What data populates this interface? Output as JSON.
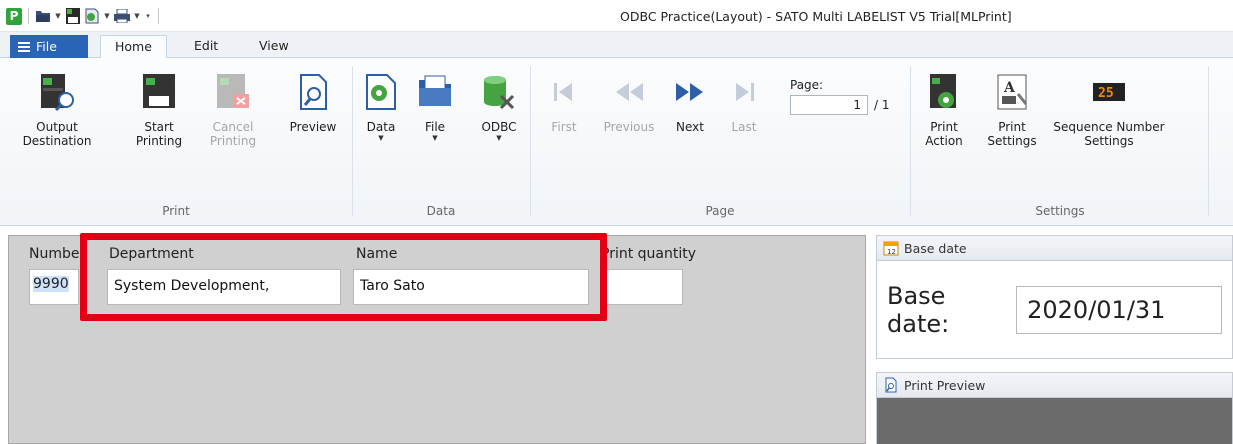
{
  "window": {
    "title": "ODBC Practice(Layout) - SATO Multi LABELIST V5 Trial[MLPrint]",
    "app_icon_letter": "P"
  },
  "tabs": {
    "file": "File",
    "home": "Home",
    "edit": "Edit",
    "view": "View"
  },
  "ribbon": {
    "print_group": {
      "label": "Print",
      "output_destination": "Output\nDestination",
      "start_printing": "Start\nPrinting",
      "cancel_printing": "Cancel\nPrinting",
      "preview": "Preview"
    },
    "data_group": {
      "label": "Data",
      "data": "Data",
      "file": "File",
      "odbc": "ODBC"
    },
    "page_group": {
      "label": "Page",
      "first": "First",
      "previous": "Previous",
      "next": "Next",
      "last": "Last",
      "page_label": "Page:",
      "page_value": "1",
      "page_total": "/ 1"
    },
    "settings_group": {
      "label": "Settings",
      "print_action": "Print\nAction",
      "print_settings": "Print\nSettings",
      "sequence_number_settings": "Sequence Number\nSettings",
      "sequence_display": "25"
    }
  },
  "grid": {
    "headers": {
      "number": "Number",
      "department": "Department",
      "name": "Name",
      "print_quantity": "Print quantity"
    },
    "row": {
      "number": "9990",
      "department": "System Development,",
      "name": "Taro Sato",
      "print_quantity": ""
    }
  },
  "base_date_panel": {
    "title": "Base date",
    "label": "Base date:",
    "value": "2020/01/31"
  },
  "print_preview_panel": {
    "title": "Print Preview"
  },
  "colors": {
    "file_tab": "#2a64b7",
    "highlight": "#e40014",
    "app_icon": "#2fa43a"
  }
}
